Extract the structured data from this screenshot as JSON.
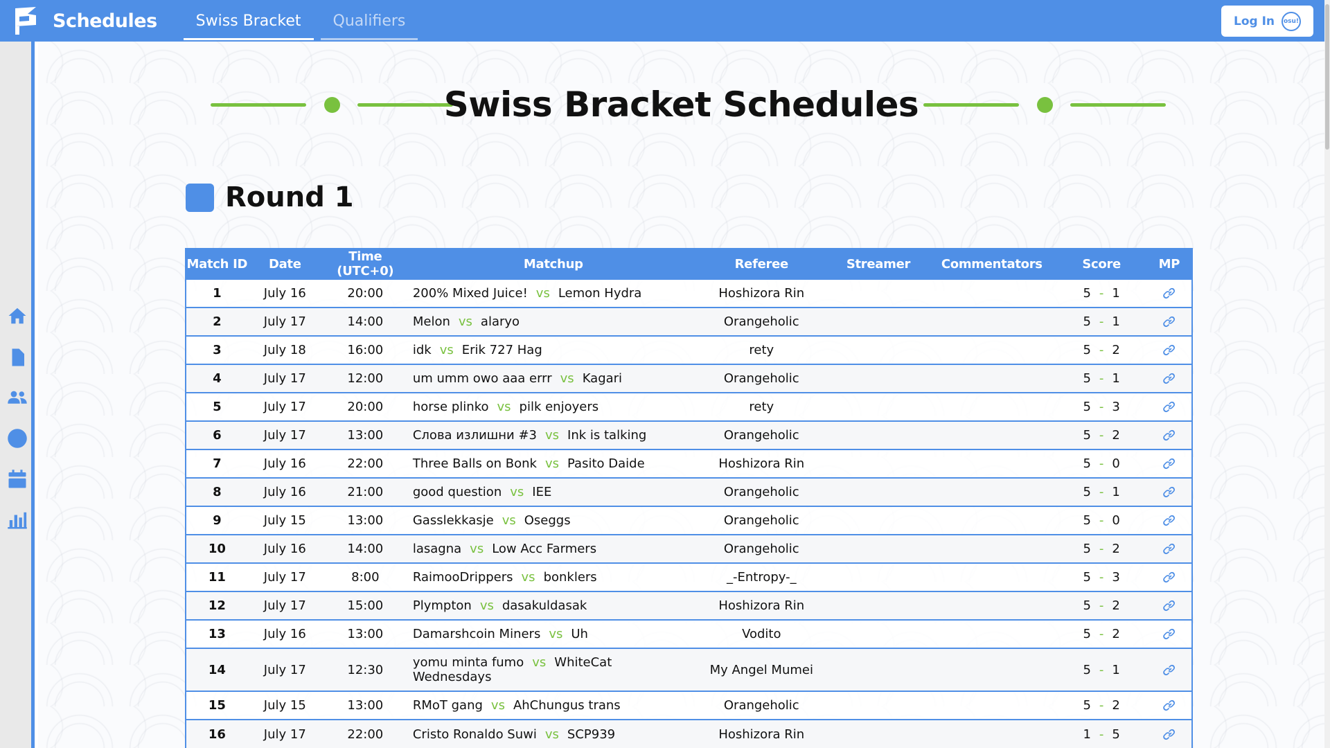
{
  "header": {
    "brand": "Schedules",
    "tabs": [
      {
        "label": "Swiss Bracket",
        "active": true
      },
      {
        "label": "Qualifiers",
        "active": false
      }
    ],
    "login_label": "Log In",
    "login_badge": "osu!"
  },
  "sidebar": {
    "icons": [
      "home-icon",
      "document-icon",
      "users-icon",
      "circle-icon",
      "calendar-icon",
      "chart-icon"
    ]
  },
  "page": {
    "title": "Swiss Bracket Schedules",
    "round_title": "Round 1"
  },
  "table": {
    "headers": {
      "match_id": "Match ID",
      "date": "Date",
      "time": "Time (UTC+0)",
      "matchup": "Matchup",
      "referee": "Referee",
      "streamer": "Streamer",
      "commentators": "Commentators",
      "score": "Score",
      "mp": "MP"
    },
    "vs_label": "vs",
    "score_sep": "-",
    "rows": [
      {
        "id": "1",
        "date": "July 16",
        "time": "20:00",
        "team1": "200% Mixed Juice!",
        "team2": "Lemon Hydra",
        "referee": "Hoshizora Rin",
        "streamer": "",
        "commentators": "",
        "score1": "5",
        "score2": "1"
      },
      {
        "id": "2",
        "date": "July 17",
        "time": "14:00",
        "team1": "Melon",
        "team2": "alaryo",
        "referee": "Orangeholic",
        "streamer": "",
        "commentators": "",
        "score1": "5",
        "score2": "1"
      },
      {
        "id": "3",
        "date": "July 18",
        "time": "16:00",
        "team1": "idk",
        "team2": "Erik 727 Hag",
        "referee": "rety",
        "streamer": "",
        "commentators": "",
        "score1": "5",
        "score2": "2"
      },
      {
        "id": "4",
        "date": "July 17",
        "time": "12:00",
        "team1": "um umm owo aaa errr",
        "team2": "Kagari",
        "referee": "Orangeholic",
        "streamer": "",
        "commentators": "",
        "score1": "5",
        "score2": "1"
      },
      {
        "id": "5",
        "date": "July 17",
        "time": "20:00",
        "team1": "horse plinko",
        "team2": "pilk enjoyers",
        "referee": "rety",
        "streamer": "",
        "commentators": "",
        "score1": "5",
        "score2": "3"
      },
      {
        "id": "6",
        "date": "July 17",
        "time": "13:00",
        "team1": "Слова излишни #3",
        "team2": "Ink is talking",
        "referee": "Orangeholic",
        "streamer": "",
        "commentators": "",
        "score1": "5",
        "score2": "2"
      },
      {
        "id": "7",
        "date": "July 16",
        "time": "22:00",
        "team1": "Three Balls on Bonk",
        "team2": "Pasito Daide",
        "referee": "Hoshizora Rin",
        "streamer": "",
        "commentators": "",
        "score1": "5",
        "score2": "0"
      },
      {
        "id": "8",
        "date": "July 16",
        "time": "21:00",
        "team1": "good question",
        "team2": "IEE",
        "referee": "Orangeholic",
        "streamer": "",
        "commentators": "",
        "score1": "5",
        "score2": "1"
      },
      {
        "id": "9",
        "date": "July 15",
        "time": "13:00",
        "team1": "Gasslekkasje",
        "team2": "Oseggs",
        "referee": "Orangeholic",
        "streamer": "",
        "commentators": "",
        "score1": "5",
        "score2": "0"
      },
      {
        "id": "10",
        "date": "July 16",
        "time": "14:00",
        "team1": "lasagna",
        "team2": "Low Acc Farmers",
        "referee": "Orangeholic",
        "streamer": "",
        "commentators": "",
        "score1": "5",
        "score2": "2"
      },
      {
        "id": "11",
        "date": "July 17",
        "time": "8:00",
        "team1": "RaimooDrippers",
        "team2": "bonklers",
        "referee": "_-Entropy-_",
        "streamer": "",
        "commentators": "",
        "score1": "5",
        "score2": "3"
      },
      {
        "id": "12",
        "date": "July 17",
        "time": "15:00",
        "team1": "Plympton",
        "team2": "dasakuldasak",
        "referee": "Hoshizora Rin",
        "streamer": "",
        "commentators": "",
        "score1": "5",
        "score2": "2"
      },
      {
        "id": "13",
        "date": "July 16",
        "time": "13:00",
        "team1": "Damarshcoin Miners",
        "team2": "Uh",
        "referee": "Vodito",
        "streamer": "",
        "commentators": "",
        "score1": "5",
        "score2": "2"
      },
      {
        "id": "14",
        "date": "July 17",
        "time": "12:30",
        "team1": "yomu minta fumo",
        "team2": "WhiteCat Wednesdays",
        "referee": "My Angel Mumei",
        "streamer": "",
        "commentators": "",
        "score1": "5",
        "score2": "1"
      },
      {
        "id": "15",
        "date": "July 15",
        "time": "13:00",
        "team1": "RMoT gang",
        "team2": "AhChungus trans",
        "referee": "Orangeholic",
        "streamer": "",
        "commentators": "",
        "score1": "5",
        "score2": "2"
      },
      {
        "id": "16",
        "date": "July 17",
        "time": "22:00",
        "team1": "Cristo Ronaldo Suwi",
        "team2": "SCP939",
        "referee": "Hoshizora Rin",
        "streamer": "",
        "commentators": "",
        "score1": "1",
        "score2": "5"
      }
    ]
  },
  "colors": {
    "accent": "#4f8fe6",
    "green": "#79c13f"
  }
}
